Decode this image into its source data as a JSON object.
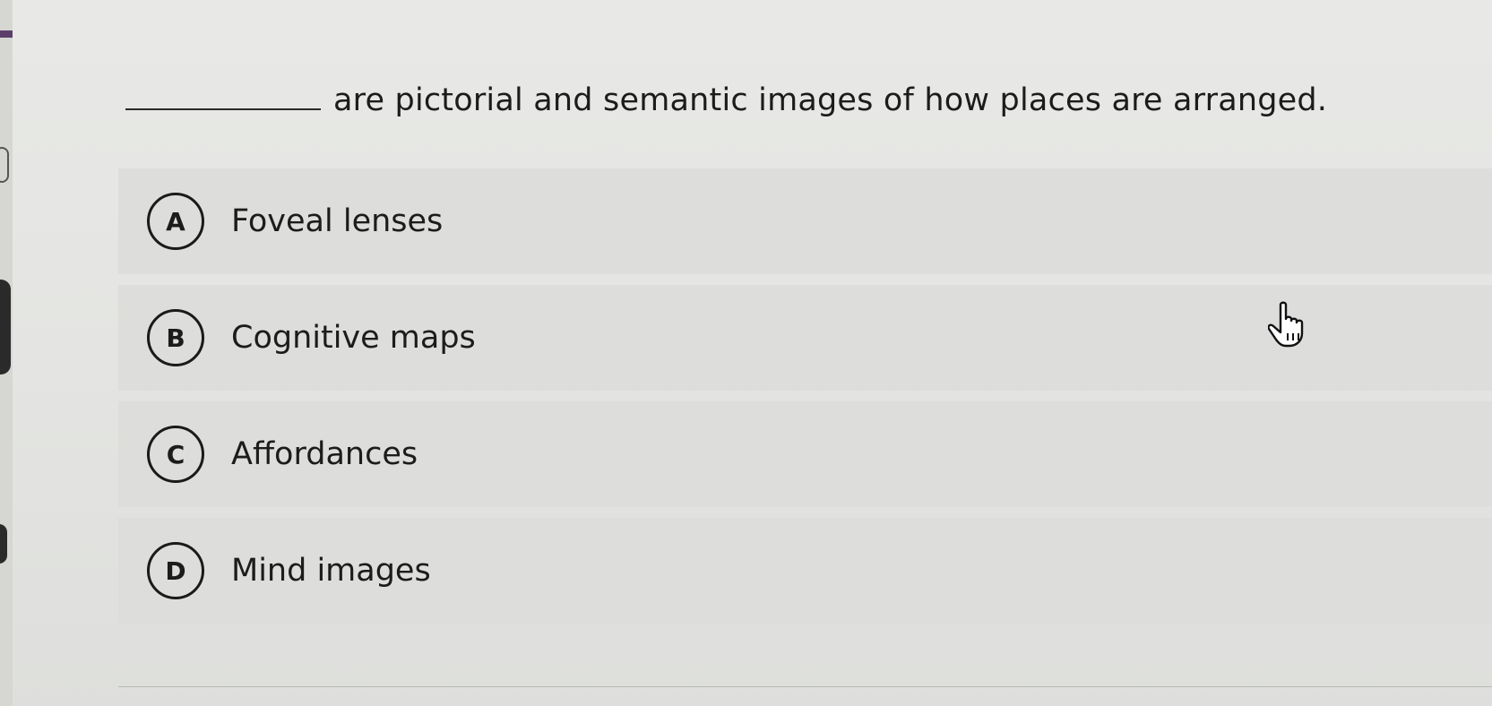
{
  "question": {
    "text": "are pictorial and semantic images of how places are arranged."
  },
  "options": [
    {
      "letter": "A",
      "label": "Foveal lenses"
    },
    {
      "letter": "B",
      "label": "Cognitive maps"
    },
    {
      "letter": "C",
      "label": "Affordances"
    },
    {
      "letter": "D",
      "label": "Mind images"
    }
  ],
  "cursor": {
    "icon": "hand-pointer-icon"
  }
}
